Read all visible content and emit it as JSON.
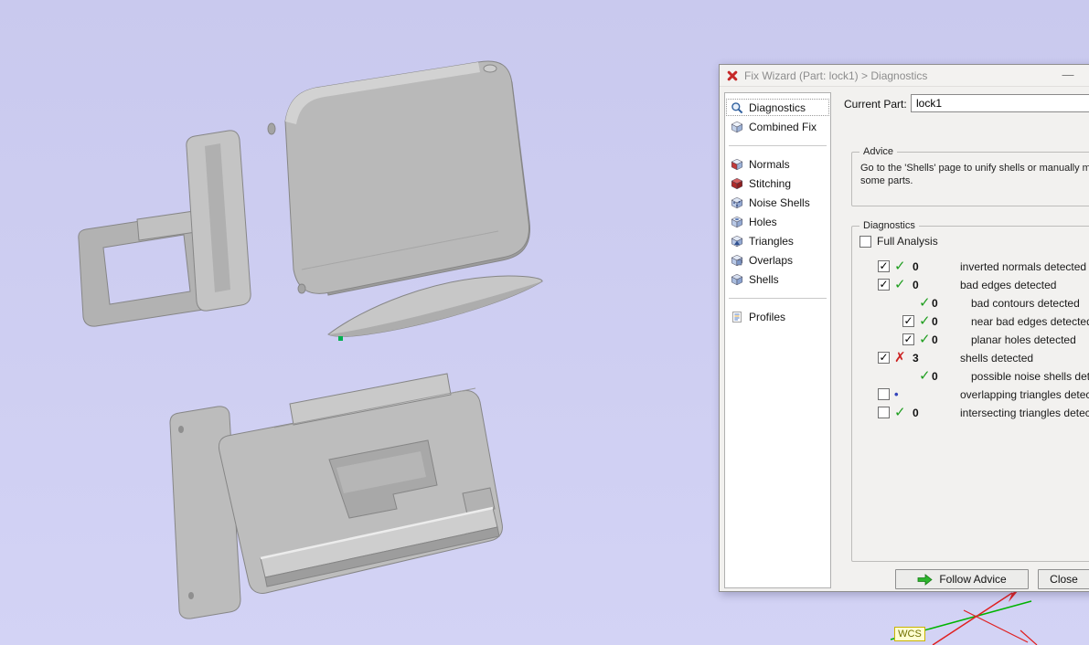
{
  "viewport": {
    "background_top": "#c9c9ee",
    "background_bottom": "#d3d3f5",
    "wcs_label": "WCS"
  },
  "colors": {
    "pass": "#1f9e1f",
    "fail": "#cc2222",
    "dot": "#3344bb",
    "follow_arrow": "#2db52d",
    "axis_green": "#00b400",
    "axis_red": "#e02020",
    "vertex_dot": "#00b050"
  },
  "dialog": {
    "title": "Fix Wizard (Part: lock1) > Diagnostics",
    "minimize_glyph": "—",
    "current_part": {
      "label": "Current Part:",
      "value": "lock1"
    },
    "sidebar": {
      "items": [
        {
          "label": "Diagnostics",
          "icon": "magnifier-icon",
          "selected": true
        },
        {
          "label": "Combined Fix",
          "icon": "combined-fix-icon"
        },
        {
          "type": "separator"
        },
        {
          "label": "Normals",
          "icon": "normals-icon"
        },
        {
          "label": "Stitching",
          "icon": "stitching-icon"
        },
        {
          "label": "Noise Shells",
          "icon": "noise-shells-icon"
        },
        {
          "label": "Holes",
          "icon": "holes-icon"
        },
        {
          "label": "Triangles",
          "icon": "triangles-icon"
        },
        {
          "label": "Overlaps",
          "icon": "overlaps-icon"
        },
        {
          "label": "Shells",
          "icon": "shells-icon"
        },
        {
          "type": "separator"
        },
        {
          "label": "Profiles",
          "icon": "profiles-icon"
        }
      ]
    },
    "advice": {
      "title": "Advice",
      "lines": [
        "Go to the 'Shells' page to unify shells or manually merge",
        "some parts."
      ]
    },
    "diagnostics": {
      "title": "Diagnostics",
      "full_analysis_label": "Full Analysis",
      "rows": [
        {
          "id": "inverted-normals",
          "checkbox": "checked",
          "status": "pass",
          "count": "0",
          "label": "inverted normals detected",
          "indent": 0
        },
        {
          "id": "bad-edges",
          "checkbox": "checked",
          "status": "pass",
          "count": "0",
          "label": "bad edges detected",
          "indent": 0
        },
        {
          "id": "bad-contours",
          "checkbox": "none",
          "status": "pass",
          "count": "0",
          "label": "bad contours detected",
          "indent": 1
        },
        {
          "id": "near-bad-edges",
          "checkbox": "checked",
          "status": "pass",
          "count": "0",
          "label": "near bad edges detected",
          "indent": 1
        },
        {
          "id": "planar-holes",
          "checkbox": "checked",
          "status": "pass",
          "count": "0",
          "label": "planar holes detected",
          "indent": 1
        },
        {
          "id": "shells",
          "checkbox": "checked",
          "status": "fail",
          "count": "3",
          "label": "shells detected",
          "indent": 0
        },
        {
          "id": "possible-noise-shells",
          "checkbox": "none",
          "status": "pass",
          "count": "0",
          "label": "possible noise shells detected",
          "indent": 1
        },
        {
          "id": "overlapping-triangles",
          "checkbox": "unchecked",
          "status": "dot",
          "count": "",
          "label": "overlapping triangles detected",
          "indent": 0
        },
        {
          "id": "intersecting-triangles",
          "checkbox": "unchecked",
          "status": "pass",
          "count": "0",
          "label": "intersecting triangles detected",
          "indent": 0
        }
      ]
    },
    "buttons": {
      "follow_advice": "Follow Advice",
      "close": "Close"
    }
  }
}
